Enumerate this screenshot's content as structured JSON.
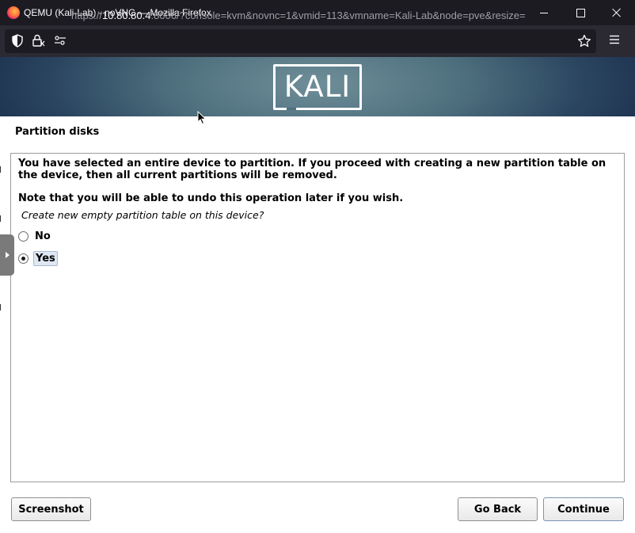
{
  "browser": {
    "window_title": "QEMU (Kali-Lab) - noVNC — Mozilla Firefox",
    "url_prefix": "https://",
    "url_host": "10.80.80.4",
    "url_rest": ":8006/?console=kvm&novnc=1&vmid=113&vmname=Kali-Lab&node=pve&resize="
  },
  "banner": {
    "logo_text": "KALI"
  },
  "installer": {
    "heading": "Partition disks",
    "paragraph1": "You have selected an entire device to partition. If you proceed with creating a new partition table on the device, then all current partitions will be removed.",
    "paragraph2": "Note that you will be able to undo this operation later if you wish.",
    "question": "Create new empty partition table on this device?",
    "options": [
      {
        "label": "No",
        "checked": false
      },
      {
        "label": "Yes",
        "checked": true
      }
    ]
  },
  "buttons": {
    "screenshot": "Screenshot",
    "go_back": "Go Back",
    "continue": "Continue"
  },
  "colors": {
    "titlebar": "#1c1b22",
    "toolbar": "#2b2a33",
    "banner_center": "#6f8e99",
    "banner_edge": "#1f3553"
  }
}
